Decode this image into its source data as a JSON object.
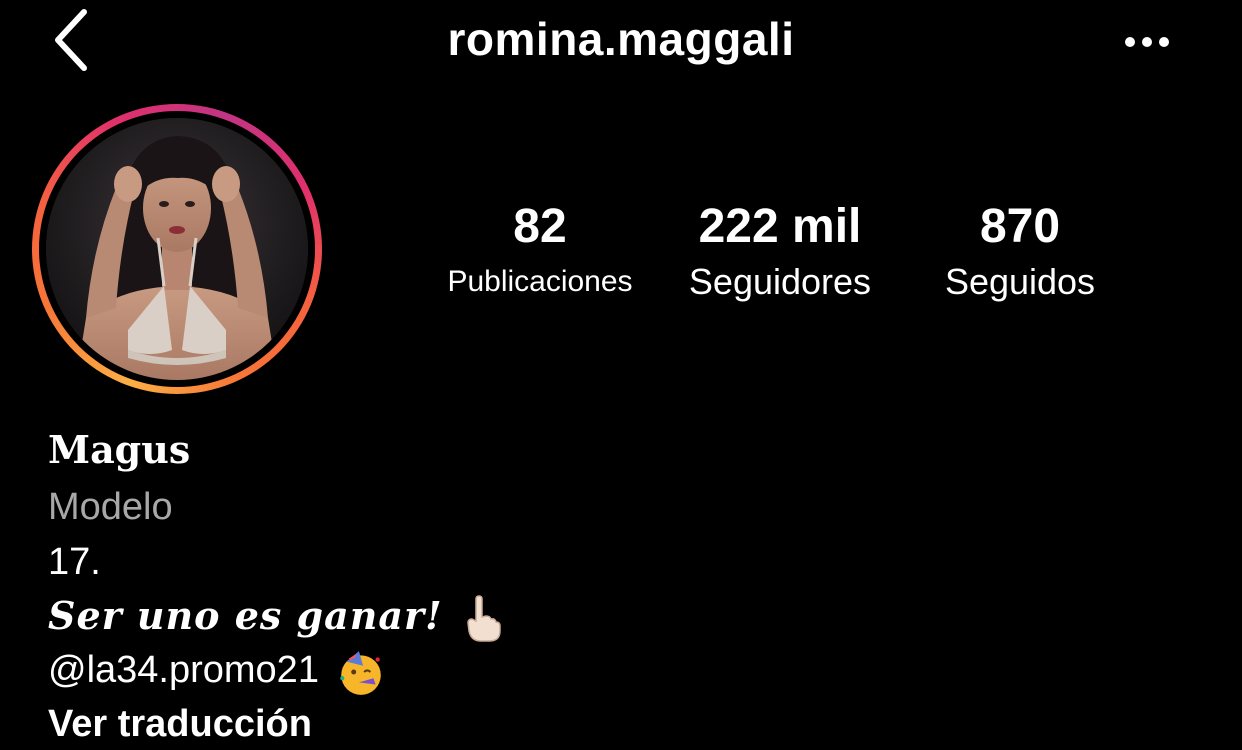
{
  "header": {
    "username": "romina.maggali"
  },
  "stats": [
    {
      "value": "82",
      "label": "Publicaciones"
    },
    {
      "value": "222 mil",
      "label": "Seguidores"
    },
    {
      "value": "870",
      "label": "Seguidos"
    }
  ],
  "bio": {
    "display_name": "Magus",
    "category": "Modelo",
    "line1": "17.",
    "line2": "Ser uno es ganar!",
    "line2_emoji": "index-pointing-up-emoji",
    "line3": "@la34.promo21",
    "line3_emoji": "partying-face-emoji",
    "translate": "Ver traducción"
  },
  "colors": {
    "background": "#000000",
    "text": "#ffffff",
    "muted": "#a8a8a8",
    "ring_gradient": [
      "#fcaf45",
      "#f77737",
      "#e1306c",
      "#c13584"
    ]
  },
  "icons": {
    "back": "chevron-left-icon",
    "more": "more-horizontal-icon"
  }
}
